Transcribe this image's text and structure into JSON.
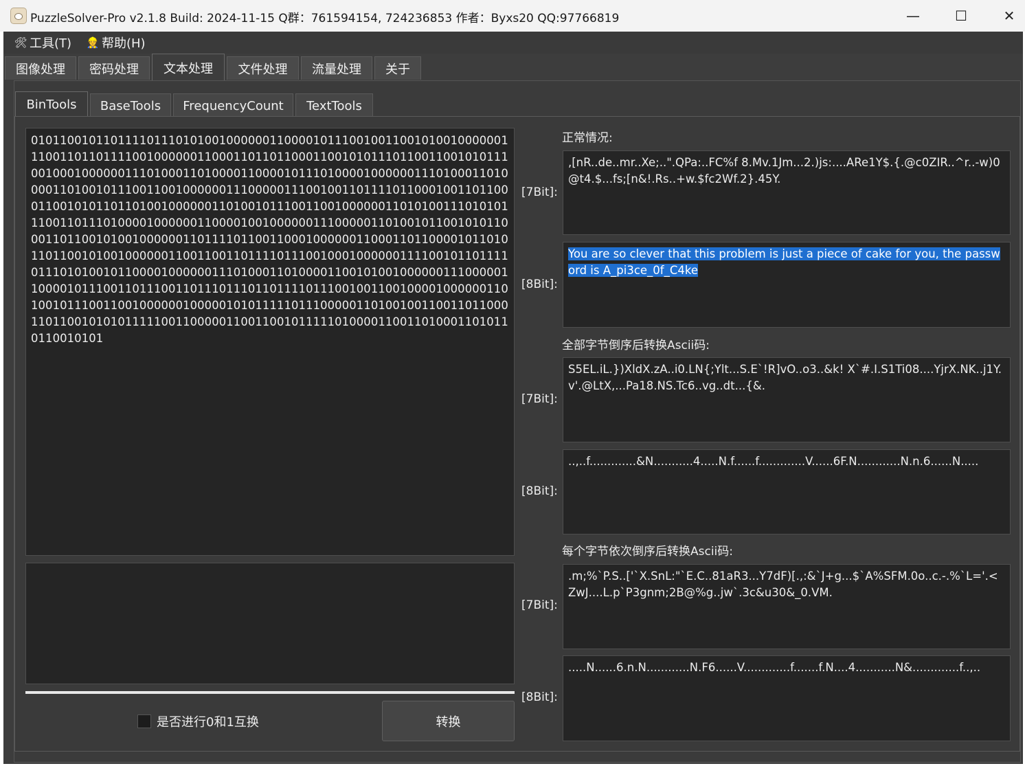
{
  "window": {
    "title": "PuzzleSolver-Pro v2.1.8  Build: 2024-11-15  Q群：761594154, 724236853  作者：Byxs20  QQ:97766819",
    "minimize": "—",
    "maximize": "☐",
    "close": "✕"
  },
  "menu": {
    "tools": "工具(T)",
    "help": "帮助(H)",
    "tools_icon": "🛠",
    "help_icon": "👷"
  },
  "main_tabs": [
    "图像处理",
    "密码处理",
    "文本处理",
    "文件处理",
    "流量处理",
    "关于"
  ],
  "main_tab_active": "文本处理",
  "sub_tabs": [
    "BinTools",
    "BaseTools",
    "FrequencyCount",
    "TextTools"
  ],
  "sub_tab_active": "BinTools",
  "input": {
    "binary": "0101100101101111011101010010000001100001011100100110010100100000011100110110111100100000011000110110110001100101011101100110010101110010001000000111010001101000011000010111010000100000011101000110100001101001011100110010000001110000011100100110111101100010011011000110010101101101001000000110100101110011001000000110101001110101011100110111010000100000011000010010000001110000011010010110010101100011011001010010000001101111011001100010000001100011011000010110101101100101001000000110011001101111011100100010000001111001011011110111010100101100001000000111010001101000011001010010000001110000011000010111001101110011011101110110111101110010011001000010000001101001011100110010000001000001010111110111000001101001001100110110001101100101010111110011000001100110010111110100001100110100011010110110010101"
  },
  "options": {
    "swap_label": "是否进行0和1互换",
    "swap_checked": false,
    "convert_button": "转换"
  },
  "sections": [
    {
      "title": "正常情况:",
      "bit7_label": "[7Bit]:",
      "bit7_text": ",[nR..de..mr..Xe;..\".QPa:..FC%f 8.Mv.1Jm...2.)js:....ARe1Y$.{.@c0ZIR..^r..-w)0@t4.$...fs;[n&!.Rs..+w.$fc2Wf.2}.45Y.",
      "bit8_label": "[8Bit]:",
      "bit8_text": "You are so clever that this problem is just a piece of cake for you, the password is A_pi3ce_0f_C4ke"
    },
    {
      "title": "全部字节倒序后转换Ascii码:",
      "bit7_label": "[7Bit]:",
      "bit7_text": "S5EL.iL.})XldX.zA..i0.LN{;Ylt...S.E`!R]vO..o3..&k! X`#.I.S1Ti08....YjrX.NK..j1Y.v'.@LtX,...Pa18.NS.Tc6..vg..dt...{&.",
      "bit8_label": "[8Bit]:",
      "bit8_text": "..,..f.............&N...........4.....N.f......f.............V......6F.N............N.n.6......N....."
    },
    {
      "title": "每个字节依次倒序后转换Ascii码:",
      "bit7_label": "[7Bit]:",
      "bit7_text": ".m;%`P.S..['`X.SnL:\"`E.C..81aR3...Y7dF)[.,:&`J+g...$`A%SFM.0o..c.-.%`L='.<ZwJ....L.p`P3gnm;2B@%g..jw`.3c&u30&_0.VM.",
      "bit8_label": "[8Bit]:",
      "bit8_text": ".....N......6.n.N............N.F6......V.............f.......f.N....4...........N&.............f..,.."
    }
  ]
}
